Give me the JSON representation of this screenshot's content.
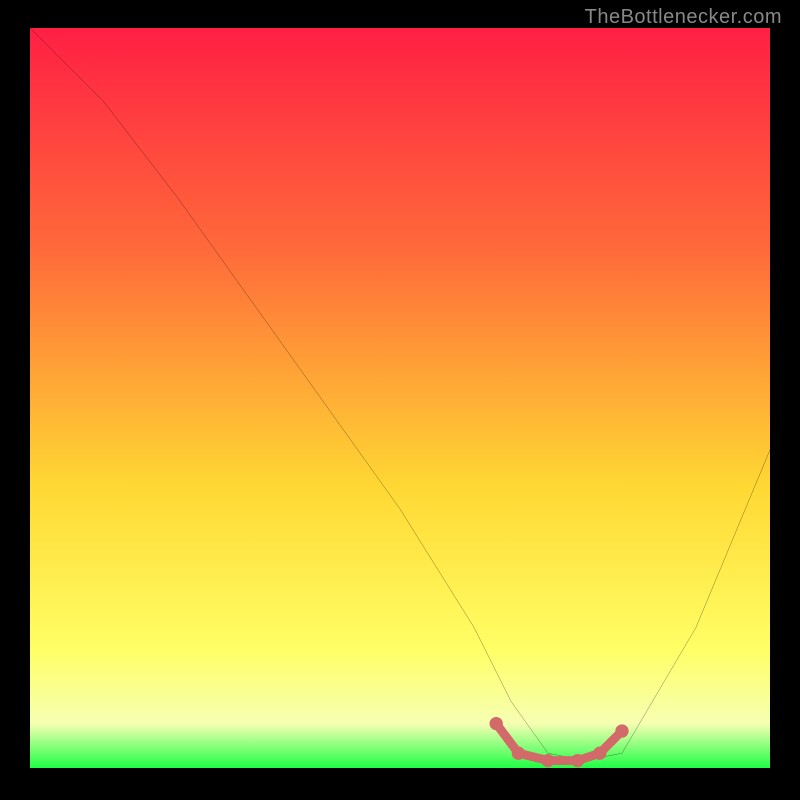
{
  "attribution": "TheBottlenecker.com",
  "chart_data": {
    "type": "line",
    "title": "",
    "xlabel": "",
    "ylabel": "",
    "xlim": [
      0,
      100
    ],
    "ylim": [
      0,
      100
    ],
    "background_gradient": {
      "top": "#ff1f44",
      "mid1": "#ff6a3a",
      "mid2": "#ffd833",
      "mid3": "#ffff66",
      "mid4": "#f6ffb2",
      "bottom": "#1fff46"
    },
    "series": [
      {
        "name": "curve",
        "color": "#000000",
        "x": [
          0,
          5,
          10,
          20,
          30,
          40,
          50,
          60,
          65,
          70,
          75,
          80,
          90,
          100
        ],
        "y": [
          100,
          95,
          90,
          77,
          63,
          49,
          35,
          19,
          9,
          2,
          1,
          2,
          19,
          43
        ]
      }
    ],
    "highlight": {
      "name": "bottom-highlight",
      "color": "#d36a6a",
      "x": [
        63,
        66,
        70,
        74,
        77,
        80
      ],
      "y": [
        6,
        2,
        1,
        1,
        2,
        5
      ]
    }
  }
}
